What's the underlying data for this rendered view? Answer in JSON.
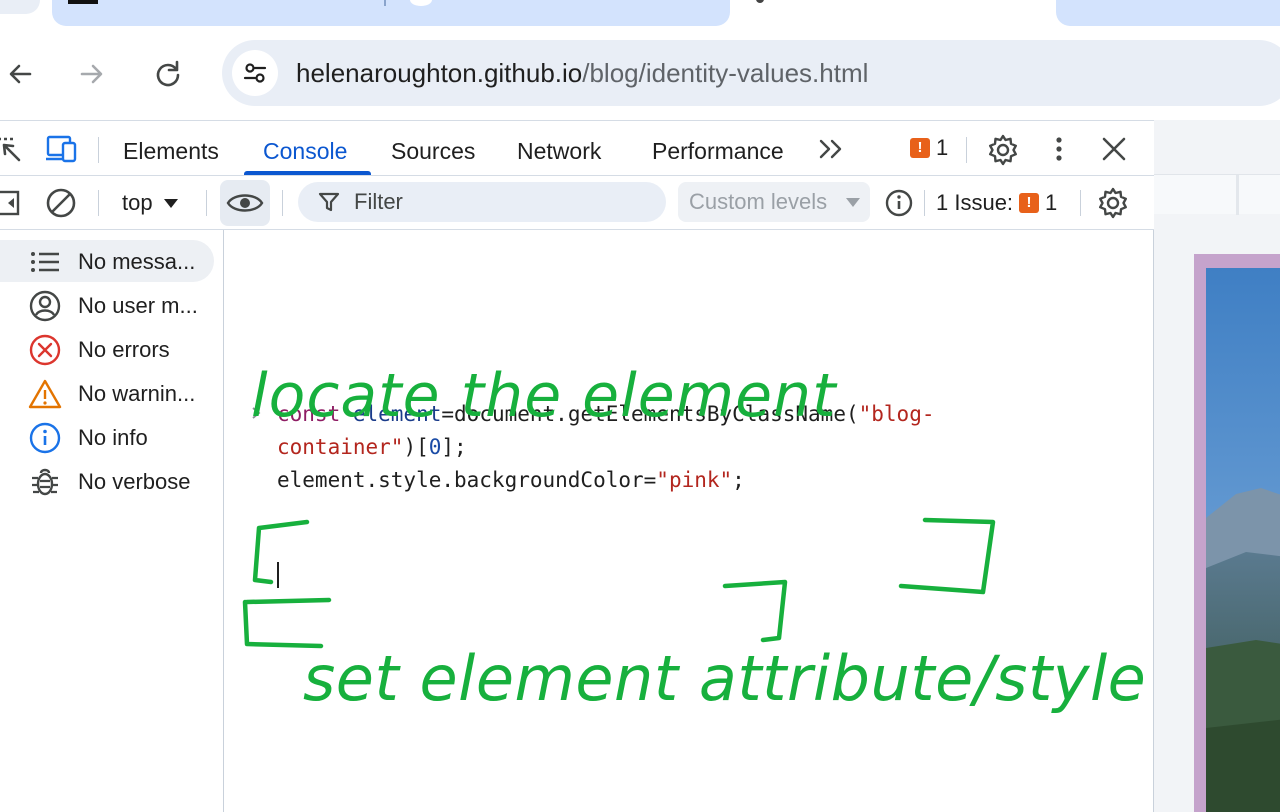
{
  "browser": {
    "address_bar": {
      "host": "helenaroughton.github.io",
      "path": "/blog/identity-values.html"
    }
  },
  "devtools": {
    "tabs": [
      "Elements",
      "Console",
      "Sources",
      "Network",
      "Performance"
    ],
    "active_tab": "Console",
    "issue_count": "1",
    "toolbar": {
      "context": "top",
      "filter_placeholder": "Filter",
      "levels": "Custom levels",
      "issues_label": "1 Issue:",
      "issues_count": "1"
    },
    "sidebar": {
      "items": [
        {
          "label": "No messa...",
          "icon": "list-icon"
        },
        {
          "label": "No user m...",
          "icon": "user-icon"
        },
        {
          "label": "No errors",
          "icon": "error-icon"
        },
        {
          "label": "No warnin...",
          "icon": "warning-icon"
        },
        {
          "label": "No info",
          "icon": "info-icon"
        },
        {
          "label": "No verbose",
          "icon": "bug-icon"
        }
      ]
    },
    "console": {
      "line1": {
        "kw": "const",
        "var": "element",
        "rest": "=document.getElementsByClassName(",
        "str": "\"blog-"
      },
      "line2": {
        "str": "container\"",
        "pre": ")[",
        "num": "0",
        "post": "];"
      },
      "line3": {
        "text": "element.style.backgroundColor=",
        "str": "\"pink\"",
        "post": ";"
      }
    }
  },
  "annotations": {
    "color": "#17b03d",
    "top_note": "locate the element",
    "bottom_note": "set element attribute/style"
  }
}
